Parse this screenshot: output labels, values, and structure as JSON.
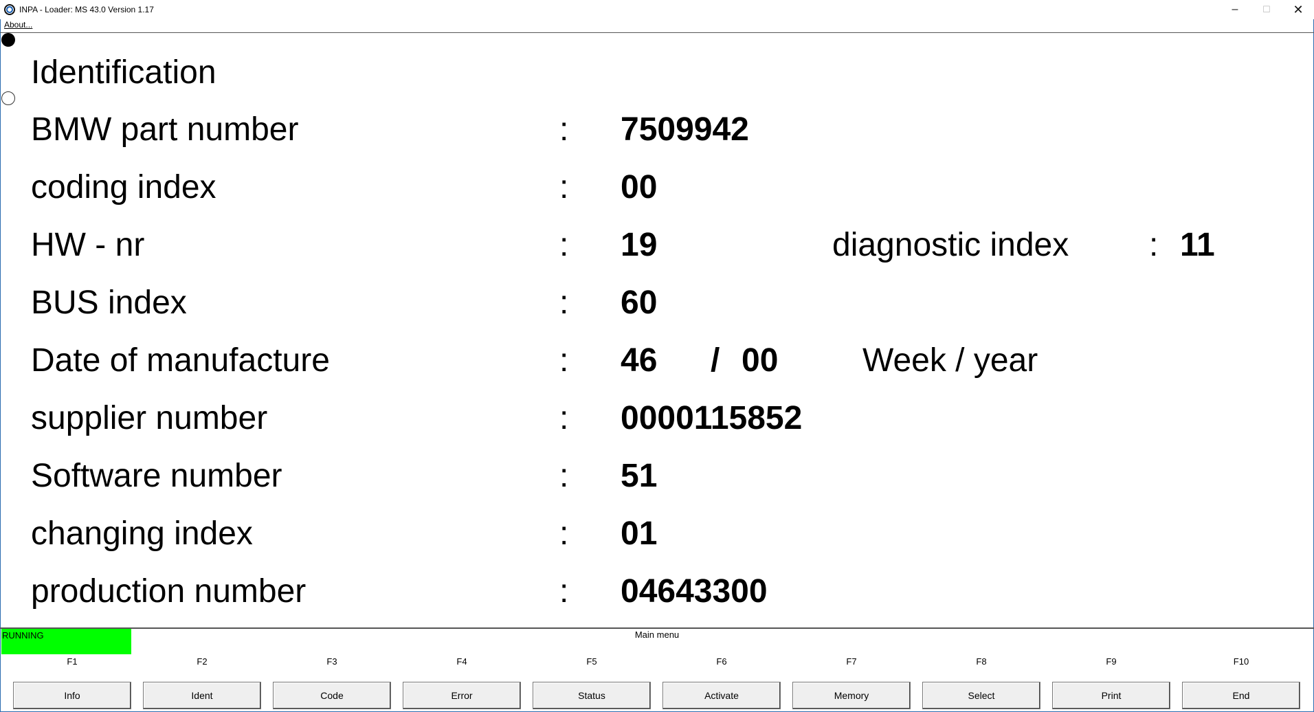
{
  "window": {
    "title": "INPA - Loader:  MS 43.0 Version 1.17",
    "minimize": "–",
    "maximize": "☐",
    "close": "✕"
  },
  "menu": {
    "about": "About..."
  },
  "content": {
    "heading": "Identification",
    "rows": [
      {
        "label": "BMW part number",
        "colon": ":",
        "value": "7509942"
      },
      {
        "label": "coding index",
        "colon": ":",
        "value": "00"
      },
      {
        "label": "HW - nr",
        "colon": ":",
        "value": "19",
        "extra_label": "diagnostic index",
        "extra_colon": ":",
        "extra_value": "11"
      },
      {
        "label": "BUS index",
        "colon": ":",
        "value": "60"
      },
      {
        "label": "Date of manufacture",
        "colon": ":",
        "value": "46",
        "slash": "/",
        "value2": "00",
        "extra_label": "Week / year"
      },
      {
        "label": "supplier number",
        "colon": ":",
        "value": "0000115852"
      },
      {
        "label": "Software number",
        "colon": ":",
        "value": "51"
      },
      {
        "label": "changing index",
        "colon": ":",
        "value": "01"
      },
      {
        "label": "production number",
        "colon": ":",
        "value": "04643300"
      }
    ]
  },
  "status": {
    "running": "RUNNING",
    "running_color": "#00ff00",
    "menu_title": "Main menu"
  },
  "function_keys": [
    {
      "key": "F1",
      "label": "Info"
    },
    {
      "key": "F2",
      "label": "Ident"
    },
    {
      "key": "F3",
      "label": "Code"
    },
    {
      "key": "F4",
      "label": "Error"
    },
    {
      "key": "F5",
      "label": "Status"
    },
    {
      "key": "F6",
      "label": "Activate"
    },
    {
      "key": "F7",
      "label": "Memory"
    },
    {
      "key": "F8",
      "label": "Select"
    },
    {
      "key": "F9",
      "label": "Print"
    },
    {
      "key": "F10",
      "label": "End"
    }
  ]
}
